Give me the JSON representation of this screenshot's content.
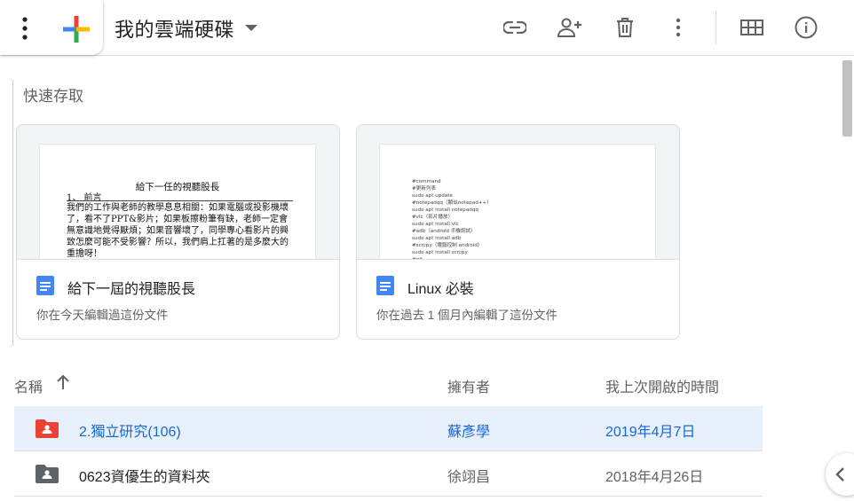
{
  "header": {
    "title": "我的雲端硬碟",
    "tools": [
      {
        "icon": "link-icon"
      },
      {
        "icon": "add-person-icon"
      },
      {
        "icon": "trash-icon"
      },
      {
        "icon": "more-vert-icon"
      },
      {
        "icon": "grid-view-icon"
      },
      {
        "icon": "info-icon"
      }
    ]
  },
  "quick_access": {
    "title": "快速存取",
    "cards": [
      {
        "name": "給下一屆的視聽股長",
        "subtitle": "你在今天編輯過這份文件",
        "preview": {
          "heading": "給下一任的視聽股長",
          "section": "1、 前言",
          "body": "我們的工作與老師的教學息息相關：如果電腦或投影機壞了，看不了PPT&影片；如果板擦粉筆有缺，老師一定會無意識地覺得厭煩；如果音響壞了，同學專心看影片的興致怎麼可能不受影響？所以，我們肩上扛著的是多麼大的重擔呀！"
        }
      },
      {
        "name": "Linux 必裝",
        "subtitle": "你在過去 1 個月內編輯了這份文件",
        "preview": {
          "code": "#command\n#更新列表\nsudo apt update\n#notepadqq（類似notepad++）\nsudo apt install notepadqq\n#vlc（影片播放）\nsudo apt install vlc\n#adb（android 手機調試）\nsudo apt install adb\n#scrcpy（電腦控制 android）\nsudo apt install scrcpy\n#git"
        }
      }
    ]
  },
  "table": {
    "headers": {
      "name": "名稱",
      "owner": "擁有者",
      "last_opened": "我上次開啟的時間"
    },
    "rows": [
      {
        "name": "2.獨立研究(106)",
        "owner": "蘇彥學",
        "date": "2019年4月7日",
        "folder_color": "#ea4335",
        "selected": true
      },
      {
        "name": "0623資優生的資料夾",
        "owner": "徐翊昌",
        "date": "2018年4月26日",
        "folder_color": "#5f6368",
        "selected": false
      }
    ]
  },
  "colors": {
    "accent": "#1967d2",
    "selected_row": "#e8f0fe",
    "doc_blue": "#4285f4"
  }
}
